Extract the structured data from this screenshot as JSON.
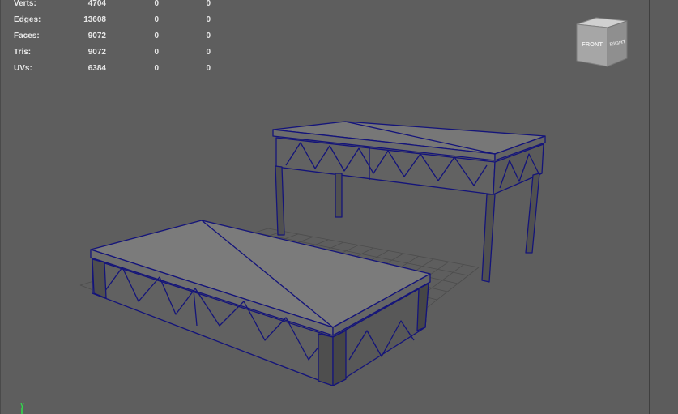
{
  "heads_up_display": {
    "rows": [
      {
        "label": "Verts:",
        "values": [
          "4704",
          "0",
          "0"
        ]
      },
      {
        "label": "Edges:",
        "values": [
          "13608",
          "0",
          "0"
        ]
      },
      {
        "label": "Faces:",
        "values": [
          "9072",
          "0",
          "0"
        ]
      },
      {
        "label": "Tris:",
        "values": [
          "9072",
          "0",
          "0"
        ]
      },
      {
        "label": "UVs:",
        "values": [
          "6384",
          "0",
          "0"
        ]
      }
    ]
  },
  "view_cube": {
    "front_label": "FRONT",
    "right_label": "RIGHT"
  },
  "axis_indicator": {
    "y_label": "y"
  },
  "colors": {
    "viewport_bg": "#5e5e5e",
    "wireframe": "#14147a",
    "grid": "#4c4c4c",
    "hud_text": "#e8e8e8",
    "axis_y": "#2ee04a"
  }
}
